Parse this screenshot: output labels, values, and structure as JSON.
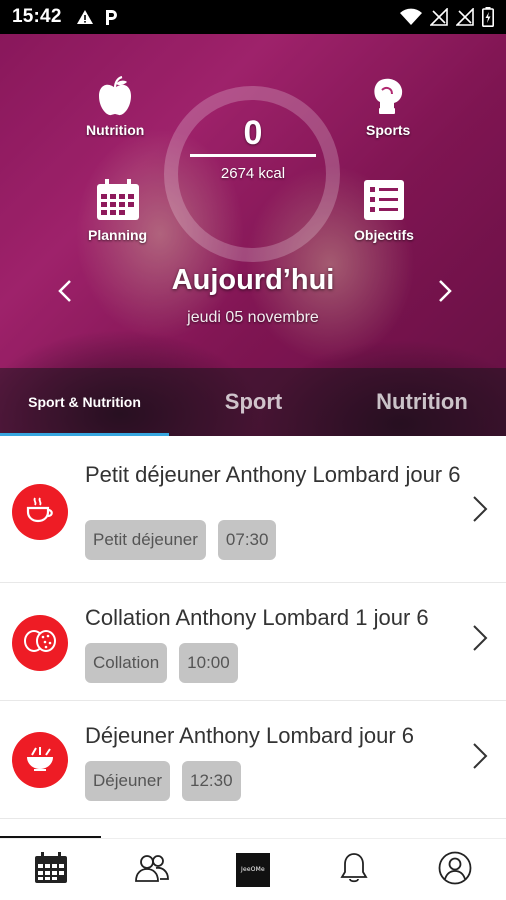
{
  "status_bar": {
    "time": "15:42",
    "icons": [
      "warning-icon",
      "parking-icon",
      "wifi-icon",
      "no-signal-icon",
      "no-signal-icon",
      "battery-charging-icon"
    ]
  },
  "hero": {
    "nutrition_label": "Nutrition",
    "sports_label": "Sports",
    "planning_label": "Planning",
    "objectifs_label": "Objectifs",
    "kcal_value": "0",
    "kcal_total": "2674 kcal",
    "day_title": "Aujourd’hui",
    "day_date": "jeudi 05 novembre"
  },
  "tabs": [
    {
      "label": "Sport & Nutrition",
      "active": true
    },
    {
      "label": "Sport",
      "active": false
    },
    {
      "label": "Nutrition",
      "active": false
    }
  ],
  "meals": [
    {
      "title": "Petit déjeuner Anthony Lombard jour 6",
      "type": "Petit déjeuner",
      "time": "07:30",
      "icon": "coffee-cup-icon"
    },
    {
      "title": "Collation Anthony Lombard 1 jour 6",
      "type": "Collation",
      "time": "10:00",
      "icon": "cookies-icon"
    },
    {
      "title": "Déjeuner Anthony Lombard jour 6",
      "type": "Déjeuner",
      "time": "12:30",
      "icon": "meal-bowl-icon"
    }
  ],
  "bottom_nav": {
    "items": [
      "calendar-icon",
      "community-icon",
      "brand-logo",
      "bell-icon",
      "profile-icon"
    ],
    "brand_text": "JeeOMe"
  },
  "colors": {
    "accent": "#37a6df",
    "meal_icon_bg": "#ee1c25",
    "chip_bg": "#c4c4c4"
  }
}
